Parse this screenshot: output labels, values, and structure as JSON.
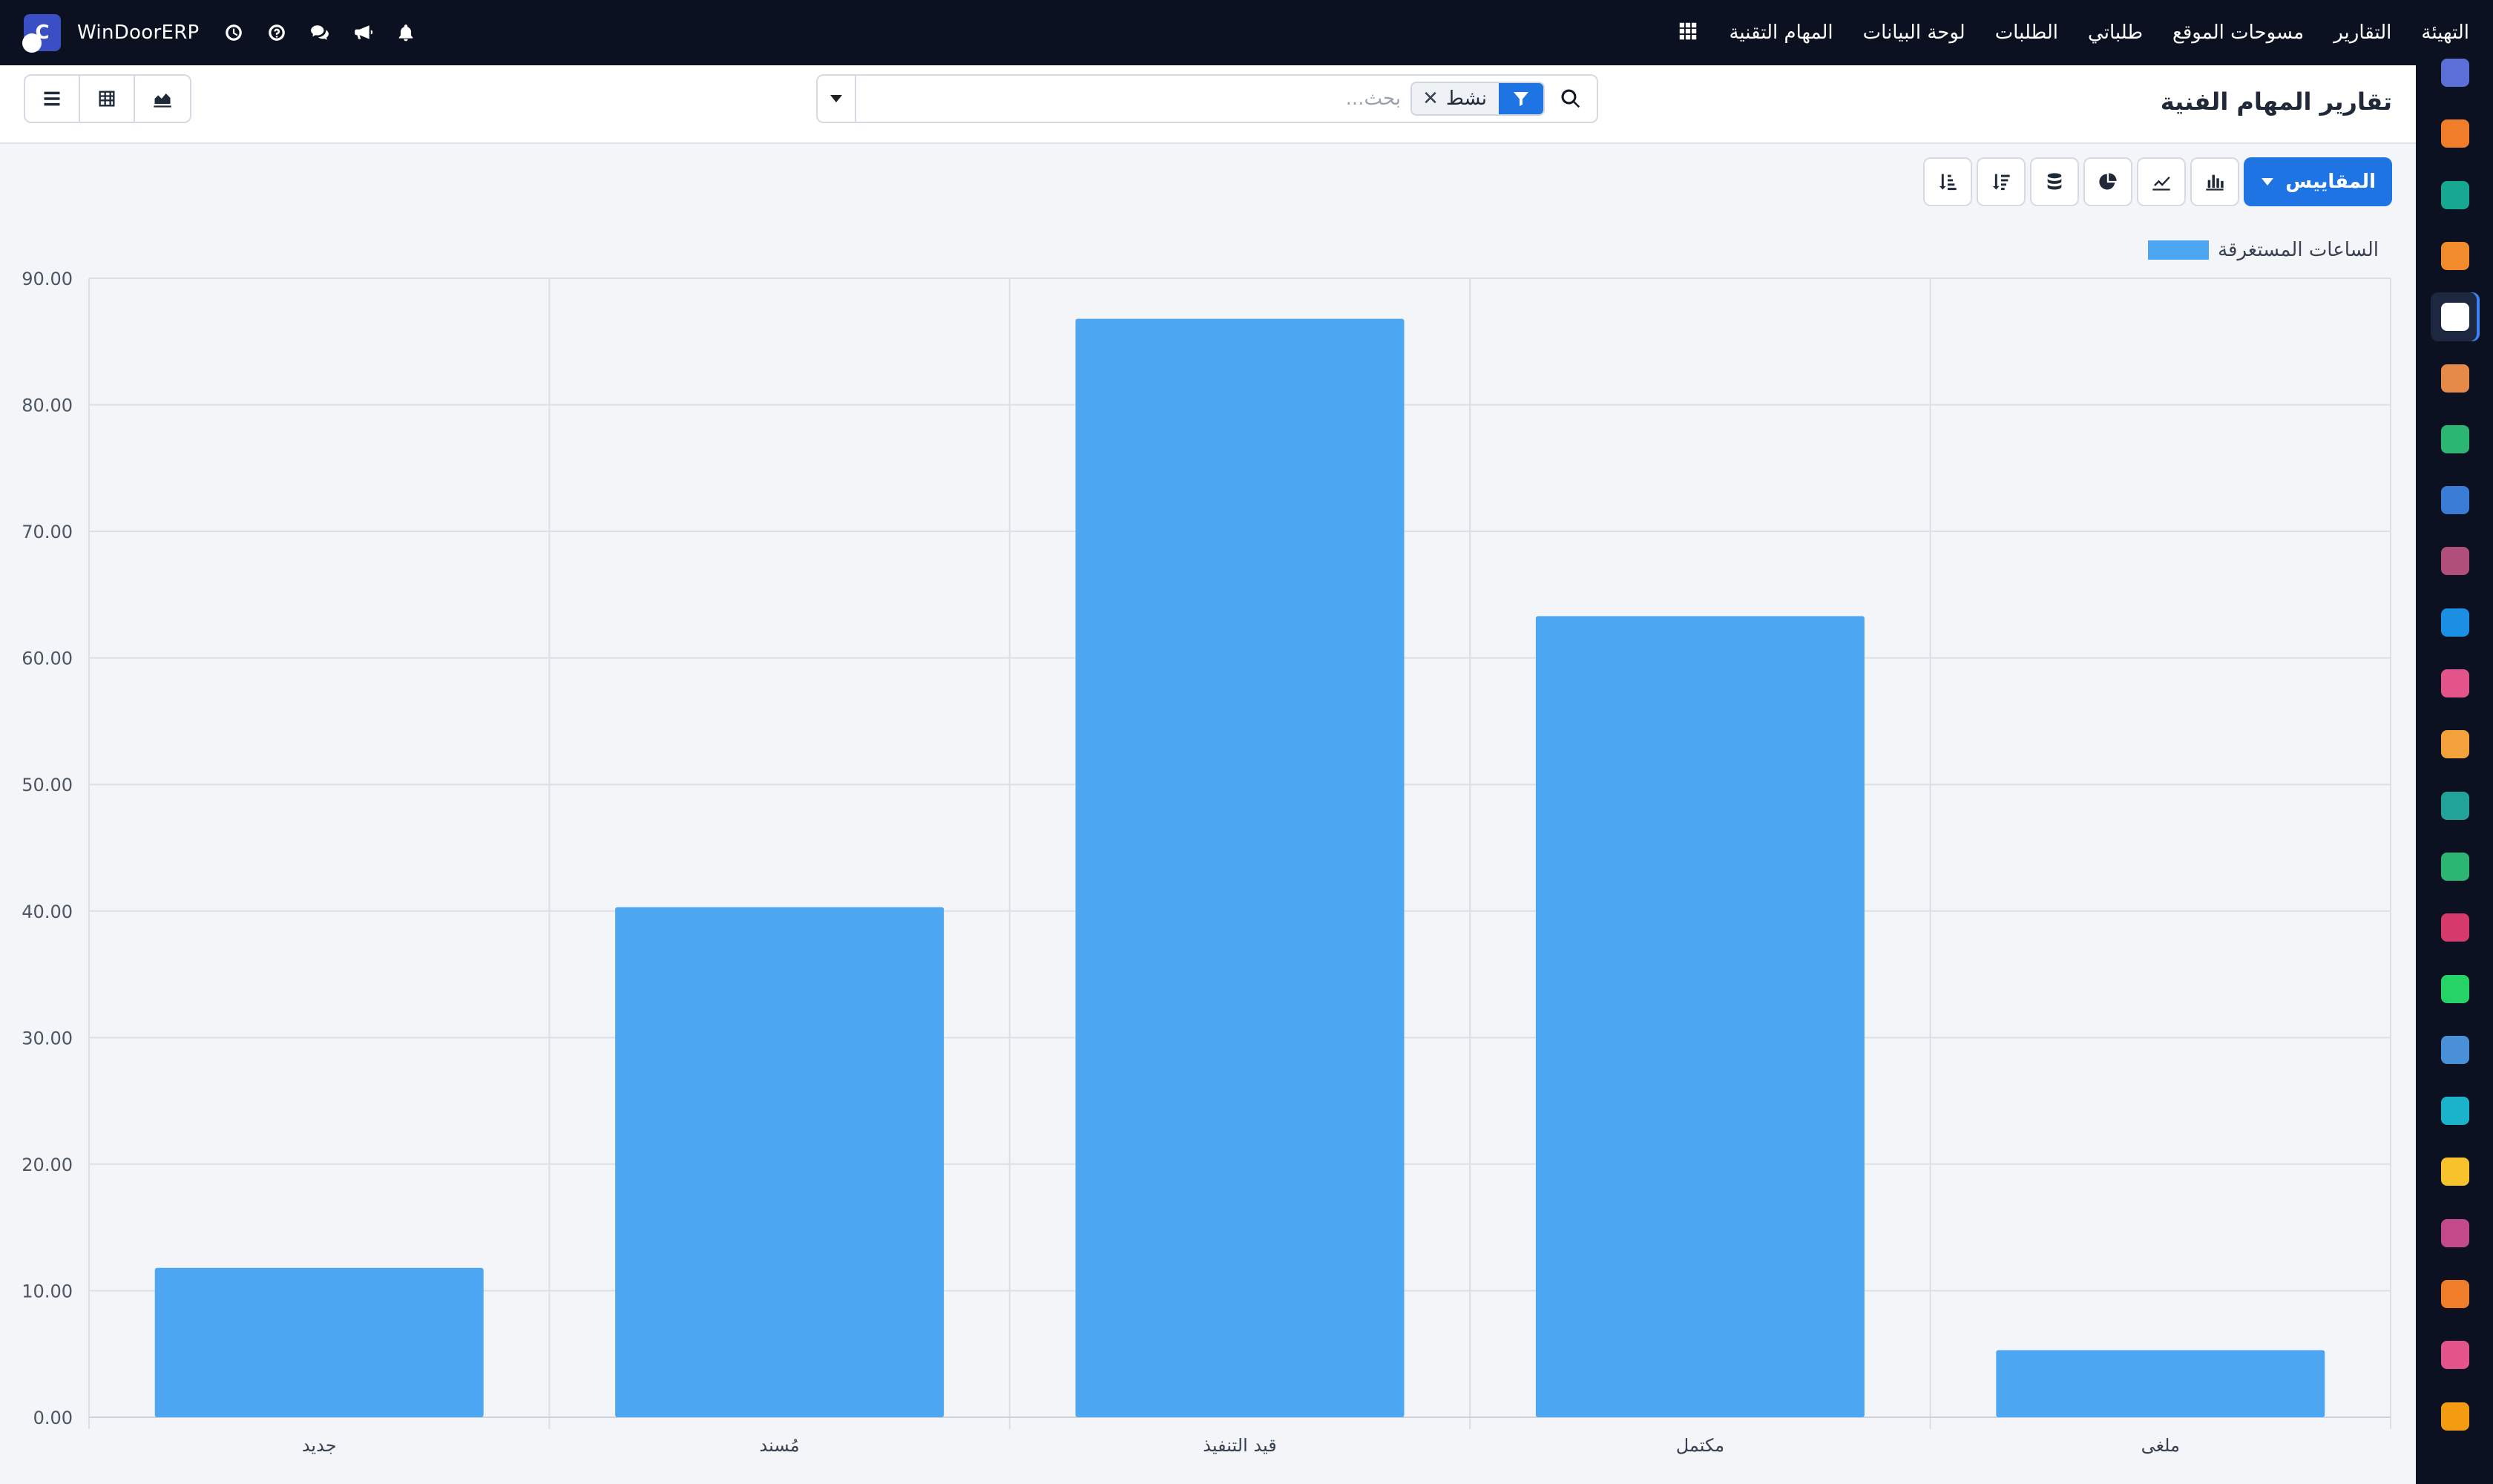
{
  "navbar": {
    "brand": "WinDoorERP",
    "brand_initial": "C",
    "menu": [
      "المهام التقنية",
      "لوحة البيانات",
      "الطلبات",
      "طلباتي",
      "مسوحات الموقع",
      "التقارير",
      "التهيئة"
    ],
    "icons": [
      "clock-icon",
      "help-icon",
      "chat-icon",
      "megaphone-icon",
      "bell-icon",
      "apps-grid-icon"
    ]
  },
  "control_panel": {
    "title": "تقارير المهام الفنية",
    "search_placeholder": "بحث...",
    "facet_value": "نشط",
    "facet_remove": "✕"
  },
  "toolbar": {
    "measures_label": "المقاييس",
    "buttons": [
      "bar-chart-icon",
      "line-chart-icon",
      "pie-chart-icon",
      "stacked-icon",
      "sort-descending-icon",
      "sort-ascending-icon"
    ]
  },
  "views": [
    "graph-view-icon",
    "pivot-view-icon",
    "list-view-icon"
  ],
  "sidebar_apps": [
    {
      "name": "app-m",
      "color": "#5b6fd6"
    },
    {
      "name": "app-chat-orange",
      "color": "#f07d2a"
    },
    {
      "name": "app-green-check",
      "color": "#16a890"
    },
    {
      "name": "app-bars",
      "color": "#f28b2c"
    },
    {
      "name": "app-cube",
      "color": "#ffffff"
    },
    {
      "name": "app-contacts",
      "color": "#e68a4a"
    },
    {
      "name": "app-tasks",
      "color": "#2bb673"
    },
    {
      "name": "app-knowledge",
      "color": "#3a7bd5"
    },
    {
      "name": "app-inventory",
      "color": "#b0507a"
    },
    {
      "name": "app-invoicing",
      "color": "#1a8fe3"
    },
    {
      "name": "app-employees",
      "color": "#e2548a"
    },
    {
      "name": "app-calendar",
      "color": "#f3a23b"
    },
    {
      "name": "app-sign",
      "color": "#21a39a"
    },
    {
      "name": "app-directory",
      "color": "#2bb673"
    },
    {
      "name": "app-dashboards",
      "color": "#d63a6a"
    },
    {
      "name": "app-whatsapp",
      "color": "#25d366"
    },
    {
      "name": "app-timer",
      "color": "#4a90d9"
    },
    {
      "name": "app-website",
      "color": "#1bb3c9"
    },
    {
      "name": "app-send",
      "color": "#f7c22b"
    },
    {
      "name": "app-cards",
      "color": "#c24a8a"
    },
    {
      "name": "app-hex-orange",
      "color": "#f07d2a"
    },
    {
      "name": "app-wheel",
      "color": "#e2548a"
    },
    {
      "name": "app-hex-last",
      "color": "#f39c12"
    }
  ],
  "chart_data": {
    "type": "bar",
    "categories": [
      "جديد",
      "مُسند",
      "قيد التنفيذ",
      "مكتمل",
      "ملغى"
    ],
    "series": [
      {
        "name": "الساعات المستغرقة",
        "values": [
          11.8,
          40.3,
          86.8,
          63.3,
          5.3
        ],
        "color": "#4da6f2"
      }
    ],
    "ylim": [
      0,
      90
    ],
    "yticks": [
      "0.00",
      "10.00",
      "20.00",
      "30.00",
      "40.00",
      "50.00",
      "60.00",
      "70.00",
      "80.00",
      "90.00"
    ],
    "legend_position": "top-right",
    "grid": true
  }
}
